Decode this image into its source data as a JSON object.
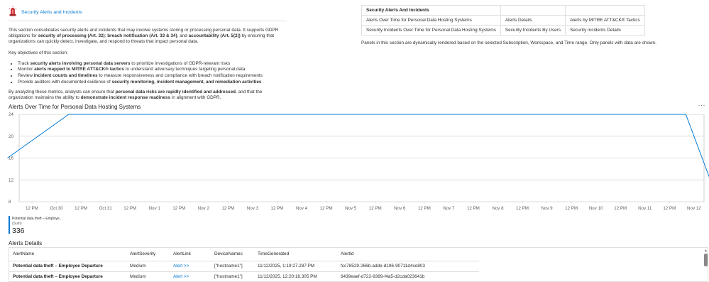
{
  "header": {
    "icon": "siren-alert-icon",
    "title": "Security Alerts and Incidents"
  },
  "intro": {
    "p1_a": "This section consolidates security alerts and incidents that may involve systems storing or processing personal data. It supports GDPR obligations for ",
    "p1_b1": "security of processing (Art. 32)",
    "p1_c": "; ",
    "p1_b2": "breach notification (Art. 33 & 34)",
    "p1_d": ", and ",
    "p1_b3": "accountability (Art. 5(2))",
    "p1_e": " by ensuring that organizations can quickly detect, investigate, and respond to threats that impact personal data.",
    "objectives_heading": "Key objectives of this section:",
    "bullets": [
      {
        "pre": "Track ",
        "bold": "security alerts involving personal data servers",
        "post": " to prioritize investigations of GDPR-relevant risks"
      },
      {
        "pre": "Monitor ",
        "bold": "alerts mapped to MITRE ATT&CK® tactics",
        "post": " to understand adversary techniques targeting personal data"
      },
      {
        "pre": "Review ",
        "bold": "incident counts and timelines",
        "post": " to measure responsiveness and compliance with breach notification requirements"
      },
      {
        "pre": "Provide auditors with documented evidence of ",
        "bold": "security monitoring, incident management, and remediation activities",
        "post": ""
      }
    ],
    "p2_a": "By analyzing these metrics, analysts can ensure that ",
    "p2_b1": "personal data risks are rapidly identified and addressed",
    "p2_c": ", and that the organization maintains the ability to ",
    "p2_b2": "demonstrate incident response readiness",
    "p2_d": " in alignment with GDPR."
  },
  "nav_table": {
    "header": "Security Alerts And Incidents",
    "rows": [
      [
        "Alerts Over Time for Personal Data Hosting Systems",
        "Alerts Details",
        "Alerts by MITRE ATT&CK® Tactics"
      ],
      [
        "Security Incidents Over Time for Personal Data Hosting Systems",
        "Security Incidents By Users",
        "Security Incidents Details"
      ]
    ],
    "note": "Panels in this section are dynamically rendered based on the selected Subscription, Workspace, and Time range. Only panels with data are shown."
  },
  "chart_section": {
    "title": "Alerts Over Time for Personal Data Hosting Systems",
    "more_icon": "ellipsis-icon",
    "more_label": "···"
  },
  "chart_data": {
    "type": "line",
    "title": "Alerts Over Time for Personal Data Hosting Systems",
    "x_ticks": [
      "12 PM",
      "Oct 30",
      "12 PM",
      "Oct 31",
      "12 PM",
      "Nov 1",
      "12 PM",
      "Nov 2",
      "12 PM",
      "Nov 3",
      "12 PM",
      "Nov 4",
      "12 PM",
      "Nov 5",
      "12 PM",
      "Nov 6",
      "12 PM",
      "Nov 7",
      "12 PM",
      "Nov 8",
      "12 PM",
      "Nov 9",
      "12 PM",
      "Nov 10",
      "12 PM",
      "Nov 11",
      "12 PM",
      "Nov 12"
    ],
    "y_ticks": [
      8,
      12,
      16,
      20,
      24
    ],
    "ylim": [
      8,
      24
    ],
    "grid": true,
    "series": [
      {
        "name": "Potential data theft – Employe...",
        "color": "#0078d4",
        "x": [
          "2025-10-29 00:00",
          "2025-10-30 06:00",
          "2025-11-11 20:00",
          "2025-11-12 12:00"
        ],
        "y": [
          16,
          24,
          24,
          8
        ]
      }
    ],
    "legend": {
      "name": "Potential data theft – Employe...",
      "aggregation": "(Sum)",
      "value": "336"
    }
  },
  "details_section": {
    "title": "Alerts Details",
    "columns": [
      "AlertName",
      "AlertSeverity",
      "AlertLink",
      "DeviceNames",
      "TimeGenerated",
      "AlertId"
    ],
    "rows": [
      [
        "Potential data theft – Employee Departure",
        "Medium",
        "Alert >>",
        "[\"hostname1\"]",
        "11/12/2025, 1:19:27.287 PM",
        "fcc78529-266b-adde-d196-90711d4ce803"
      ],
      [
        "Potential data theft – Employee Departure",
        "Medium",
        "Alert >>",
        "[\"hostname1\"]",
        "11/12/2025, 12:20:18.305 PM",
        "6439eaef-d722-9389-f4a5-d2cda023641b"
      ]
    ]
  },
  "colors": {
    "accent": "#0078d4",
    "grid": "#d2d0ce",
    "icon_red": "#d13438"
  }
}
